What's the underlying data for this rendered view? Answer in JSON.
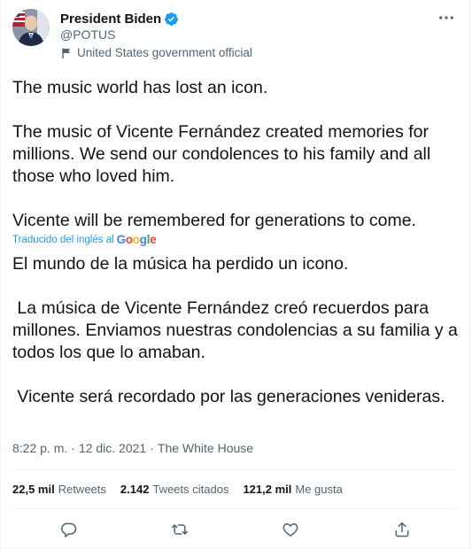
{
  "author": {
    "name": "President Biden",
    "handle": "@POTUS",
    "label": "United States government official"
  },
  "tweet": {
    "p1": "The music world has lost an icon.",
    "p2": "The music of Vicente Fernández created memories for millions. We send our condolences to his family and all those who loved him.",
    "p3": "Vicente will be remembered for generations to come."
  },
  "translation": {
    "label": "Traducido del inglés al",
    "provider": "Google",
    "p1": "El mundo de la música ha perdido un icono.",
    "p2": " La música de Vicente Fernández creó recuerdos para millones. Enviamos nuestras condolencias a su familia y a todos los que lo amaban.",
    "p3": " Vicente será recordado por las generaciones venideras."
  },
  "meta": {
    "time": "8:22 p. m.",
    "separator": "·",
    "date": "12 dic. 2021",
    "source": "The White House"
  },
  "stats": {
    "retweets_count": "22,5 mil",
    "retweets_label": "Retweets",
    "quotes_count": "2.142",
    "quotes_label": "Tweets citados",
    "likes_count": "121,2 mil",
    "likes_label": "Me gusta"
  },
  "colors": {
    "accent": "#1d9bf0",
    "text": "#0f1419",
    "secondary": "#536471"
  },
  "icons": {
    "verified": "verified-badge-icon",
    "label": "flag-icon",
    "more": "more-icon",
    "reply": "reply-icon",
    "retweet": "retweet-icon",
    "like": "heart-icon",
    "share": "share-icon"
  }
}
